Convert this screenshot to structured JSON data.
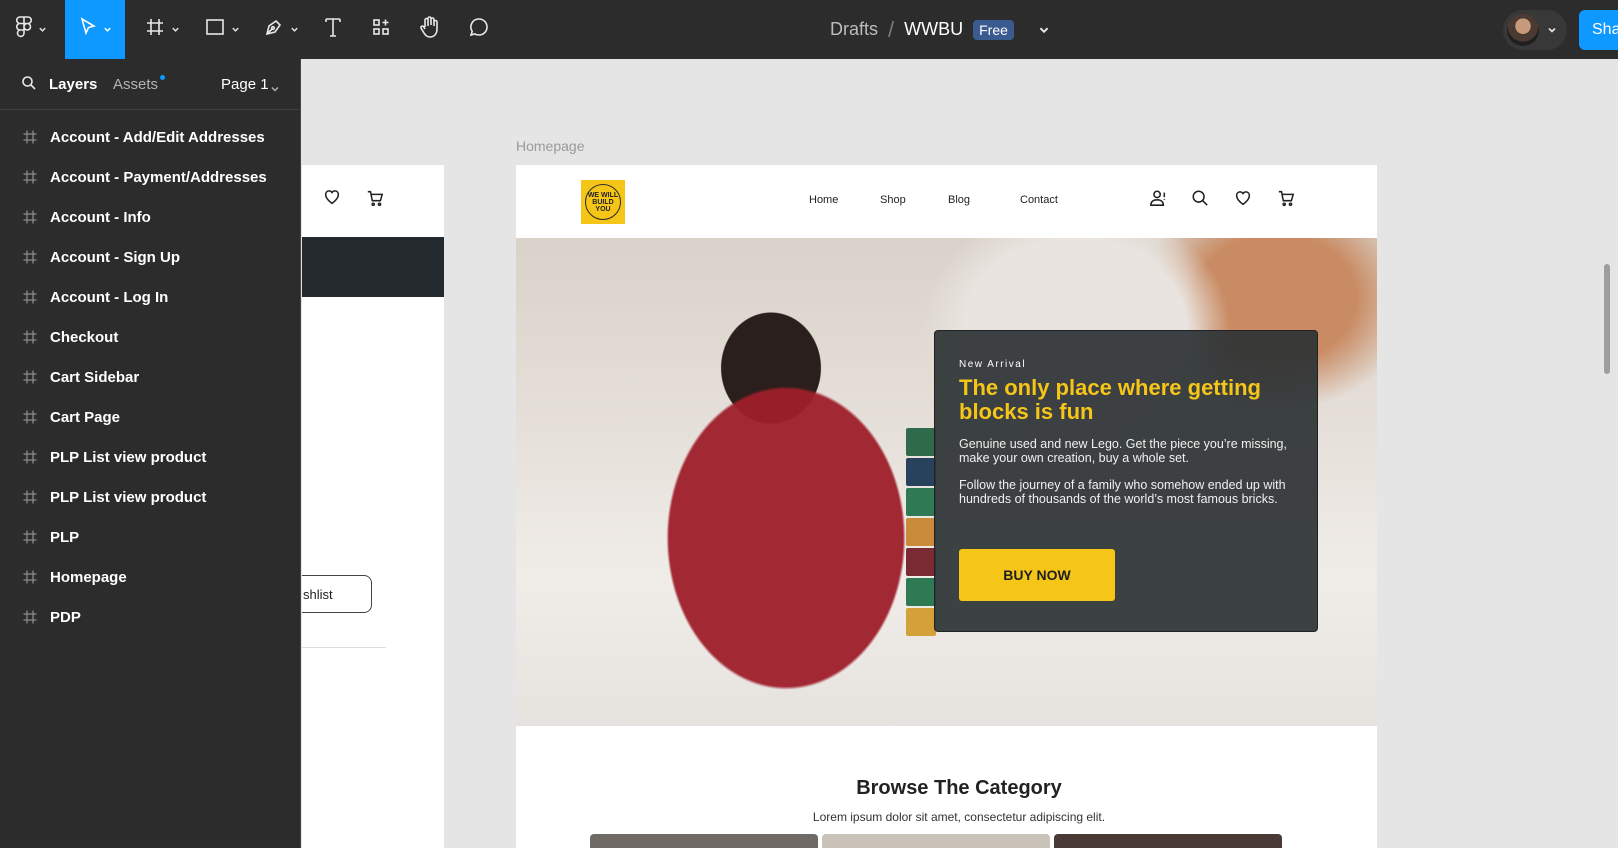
{
  "toolbar": {
    "tools": [
      {
        "name": "main-menu",
        "icon": "figma-logo-icon"
      },
      {
        "name": "move-tool",
        "icon": "cursor-arrow-icon",
        "active": true
      },
      {
        "name": "frame-tool",
        "icon": "frame-hash-icon"
      },
      {
        "name": "shape-tool",
        "icon": "rectangle-icon"
      },
      {
        "name": "pen-tool",
        "icon": "pen-icon"
      },
      {
        "name": "text-tool",
        "icon": "text-t-icon"
      },
      {
        "name": "resources-tool",
        "icon": "components-icon"
      },
      {
        "name": "hand-tool",
        "icon": "hand-icon"
      },
      {
        "name": "comment-tool",
        "icon": "comment-bubble-icon"
      }
    ],
    "breadcrumb": {
      "drafts": "Drafts",
      "separator": "/",
      "file": "WWBU",
      "plan_badge": "Free"
    },
    "share_label": "Sha",
    "accent_color": "#0d99ff"
  },
  "panel": {
    "tab_layers": "Layers",
    "tab_assets": "Assets",
    "page_selector": "Page 1",
    "layers": [
      "Account - Add/Edit Addresses",
      "Account - Payment/Addresses",
      "Account - Info",
      "Account - Sign Up",
      "Account - Log In",
      "Checkout",
      "Cart Sidebar",
      "Cart Page",
      "PLP List view product",
      "PLP List view product",
      "PLP",
      "Homepage",
      "PDP"
    ]
  },
  "canvas": {
    "left_frame": {
      "button_fragment": "shlist"
    },
    "frame_label": "Homepage",
    "site": {
      "logo_text": "WE WILL BUILD YOU",
      "nav": [
        "Home",
        "Shop",
        "Blog",
        "Contact"
      ],
      "hero": {
        "eyebrow": "New Arrival",
        "title": "The only place where getting blocks is fun",
        "paragraph1": "Genuine used and new Lego. Get the piece you’re missing, make your own creation, buy a whole set.",
        "paragraph2": "Follow the journey of a family who somehow ended up with hundreds of thousands of the world’s most famous bricks.",
        "cta": "BUY NOW"
      },
      "browse": {
        "title": "Browse The Category",
        "subtitle": "Lorem ipsum dolor sit amet, consectetur adipiscing elit."
      },
      "brand_yellow": "#f5c518",
      "dark_card": "#2c3234"
    }
  }
}
